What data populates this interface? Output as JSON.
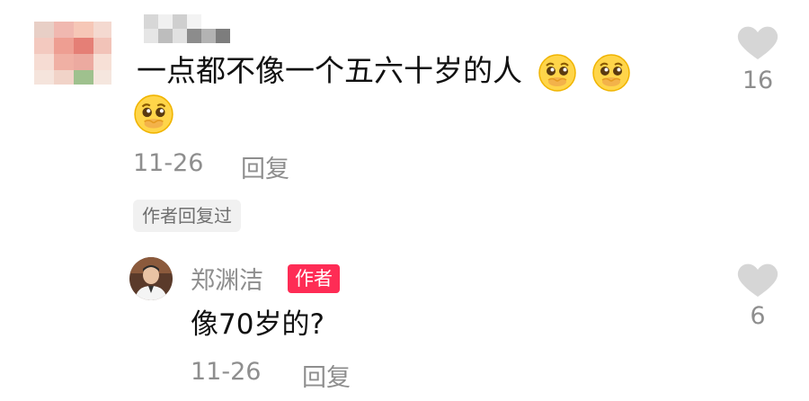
{
  "top_comment": {
    "text": "一点都不像一个五六十岁的人",
    "emoji_count": 3,
    "date": "11-26",
    "reply_label": "回复",
    "author_replied_label": "作者回复过",
    "like_count": "16",
    "emoji_icon": "pleading-face-emoji",
    "like_icon": "heart-icon"
  },
  "reply": {
    "username": "郑渊洁",
    "author_badge": "作者",
    "text": "像70岁的?",
    "date": "11-26",
    "reply_label": "回复",
    "like_count": "6",
    "like_icon": "heart-icon"
  },
  "colors": {
    "primary_text": "#111111",
    "secondary_text": "#8e8e8e",
    "author_badge_bg": "#fe2c55",
    "heart_gray": "#d6d6d6"
  }
}
